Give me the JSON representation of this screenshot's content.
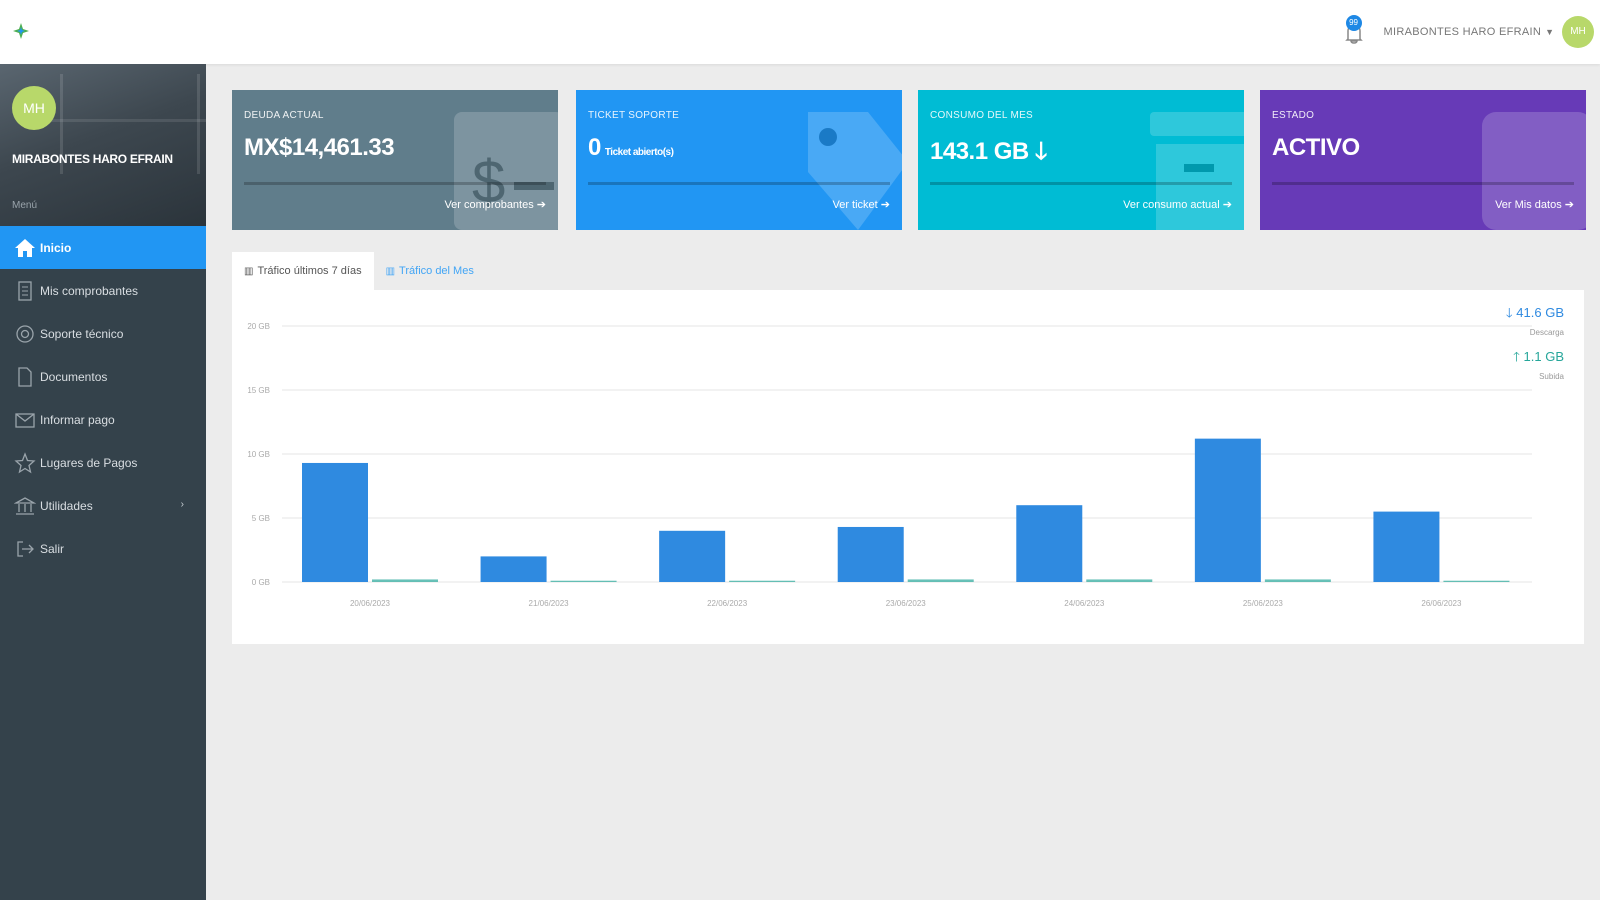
{
  "header": {
    "username": "MIRABONTES HARO EFRAIN",
    "avatar_initials": "MH",
    "notification_count": "99"
  },
  "sidebar": {
    "avatar_initials": "MH",
    "user_name": "MIRABONTES HARO EFRAIN",
    "menu_label": "Menú",
    "items": [
      {
        "label": "Inicio",
        "icon": "home-icon"
      },
      {
        "label": "Mis comprobantes",
        "icon": "document-icon"
      },
      {
        "label": "Soporte técnico",
        "icon": "support-icon"
      },
      {
        "label": "Documentos",
        "icon": "file-icon"
      },
      {
        "label": "Informar pago",
        "icon": "envelope-icon"
      },
      {
        "label": "Lugares de Pagos",
        "icon": "star-icon"
      },
      {
        "label": "Utilidades",
        "icon": "bank-icon"
      },
      {
        "label": "Salir",
        "icon": "logout-icon"
      }
    ]
  },
  "cards": [
    {
      "label": "DEUDA ACTUAL",
      "value": "MX$14,461.33",
      "value_sub": "",
      "link": "Ver comprobantes ➔",
      "color": "#607d8b"
    },
    {
      "label": "TICKET SOPORTE",
      "value": "0",
      "value_sub": "Ticket abierto(s)",
      "link": "Ver ticket ➔",
      "color": "#2196f3"
    },
    {
      "label": "CONSUMO DEL MES",
      "value": "143.1 GB 🡓",
      "value_sub": "",
      "link": "Ver consumo actual ➔",
      "color": "#00bcd4"
    },
    {
      "label": "ESTADO",
      "value": "ACTIVO",
      "value_sub": "",
      "link": "Ver Mis datos ➔",
      "color": "#673ab7"
    }
  ],
  "tabs": [
    {
      "label": "Tráfico últimos 7 días",
      "icon": "bar-chart-icon"
    },
    {
      "label": "Tráfico del Mes",
      "icon": "bar-chart-icon"
    }
  ],
  "legend": {
    "download_value": "41.6 GB",
    "download_label": "Descarga",
    "upload_value": "1.1 GB",
    "upload_label": "Subida"
  },
  "colors": {
    "download": "#2f8ae0",
    "upload": "#26a69a",
    "accent": "#2196f3"
  },
  "chart_data": {
    "type": "bar",
    "categories": [
      "20/06/2023",
      "21/06/2023",
      "22/06/2023",
      "23/06/2023",
      "24/06/2023",
      "25/06/2023",
      "26/06/2023"
    ],
    "series": [
      {
        "name": "Descarga",
        "values": [
          9.3,
          2.0,
          4.0,
          4.3,
          6.0,
          11.2,
          5.5
        ]
      },
      {
        "name": "Subida",
        "values": [
          0.2,
          0.1,
          0.1,
          0.2,
          0.2,
          0.2,
          0.1
        ]
      }
    ],
    "yticks": [
      "0 GB",
      "5 GB",
      "10 GB",
      "15 GB",
      "20 GB"
    ],
    "ylim": [
      0,
      20
    ],
    "grid": true,
    "legend_position": "top-right"
  }
}
